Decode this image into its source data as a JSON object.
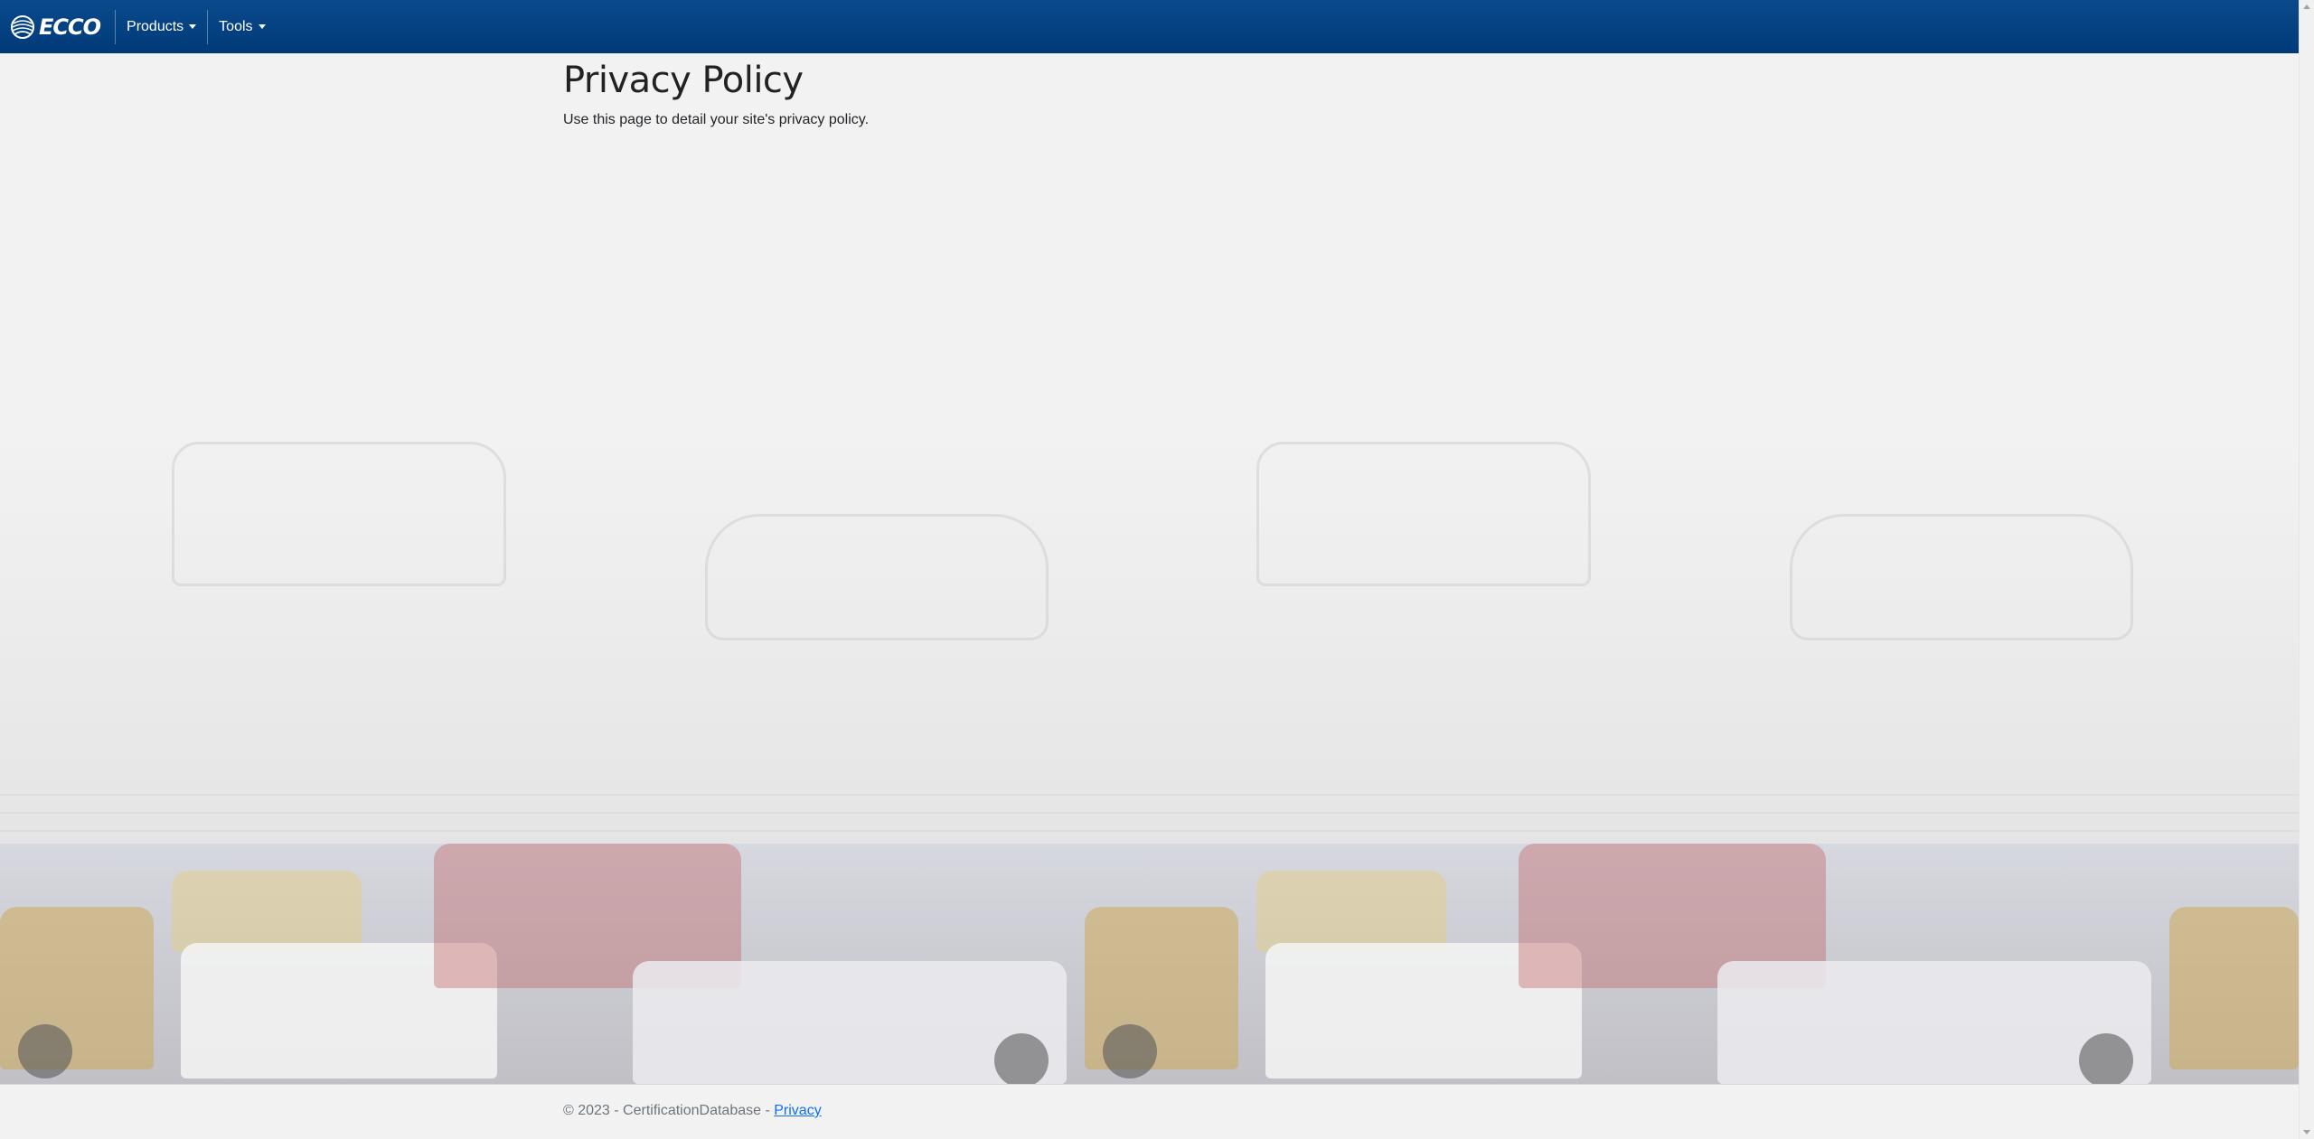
{
  "header": {
    "brand": "ECCO",
    "nav": [
      {
        "label": "Products"
      },
      {
        "label": "Tools"
      }
    ]
  },
  "main": {
    "title": "Privacy Policy",
    "description": "Use this page to detail your site's privacy policy."
  },
  "footer": {
    "copyright": "© 2023 - CertificationDatabase - ",
    "privacy_link": "Privacy"
  },
  "icons": {
    "logo": "ecco-globe-logo-icon",
    "caret": "caret-down-icon",
    "scroll_up": "scroll-up-arrow-icon",
    "scroll_down": "scroll-down-arrow-icon"
  },
  "colors": {
    "navbar": "#003a78",
    "link": "#0d6efd",
    "background": "#f2f2f2"
  }
}
